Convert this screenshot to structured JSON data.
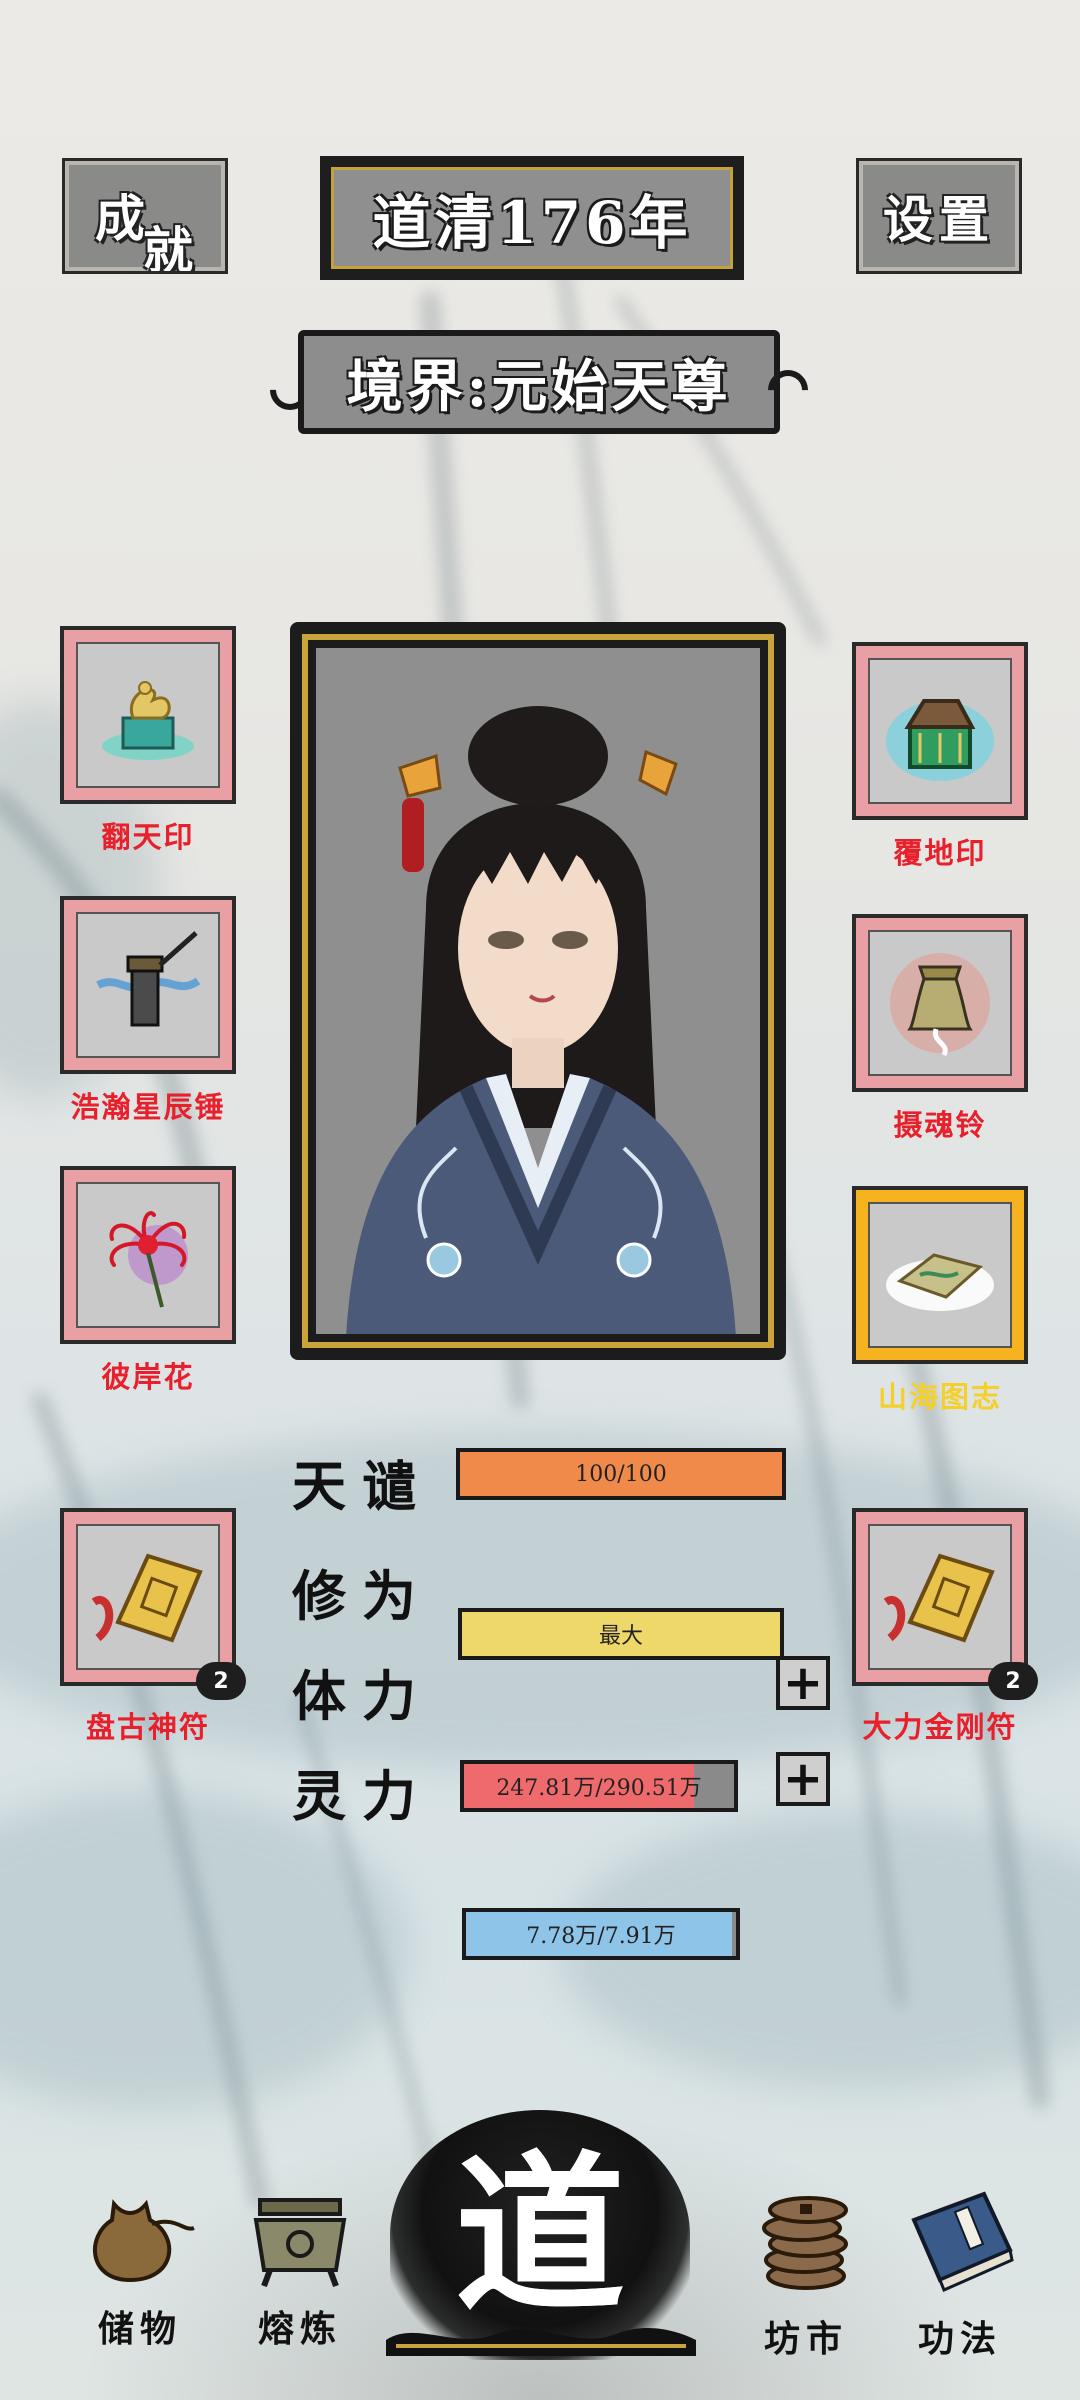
{
  "header": {
    "achievements_label": "成就",
    "achievements_char1": "成",
    "achievements_char2": "就",
    "settings_label": "设置",
    "year_title": "道清176年",
    "realm": "境界:元始天尊"
  },
  "left_slots": [
    {
      "label": "翻天印",
      "icon": "dragon-seal-icon"
    },
    {
      "label": "浩瀚星辰锤",
      "icon": "star-hammer-icon"
    },
    {
      "label": "彼岸花",
      "icon": "red-spider-lily-icon"
    },
    {
      "label": "盘古神符",
      "icon": "talisman-scroll-icon",
      "count": "2"
    }
  ],
  "right_slots": [
    {
      "label": "覆地印",
      "icon": "earth-seal-icon"
    },
    {
      "label": "摄魂铃",
      "icon": "soul-bell-icon"
    },
    {
      "label": "山海图志",
      "icon": "world-map-scroll-icon",
      "highlight": "#f7b21f"
    },
    {
      "label": "大力金刚符",
      "icon": "talisman-scroll-icon",
      "count": "2"
    }
  ],
  "stats": {
    "tianqian": {
      "label": "天谴",
      "text": "100/100",
      "fill": 1.0,
      "color": "#f08a4b"
    },
    "xiuwei": {
      "label": "修为",
      "text": "最大",
      "fill": 1.0,
      "color": "#efd86a"
    },
    "tili": {
      "label": "体力",
      "text": "247.81万/290.51万",
      "fill": 0.853,
      "color": "#ef6a6d"
    },
    "lingli": {
      "label": "灵力",
      "text": "7.78万/7.91万",
      "fill": 0.984,
      "color": "#8ec4e8"
    }
  },
  "nav": {
    "storage": "储物",
    "smelt": "熔炼",
    "dao": "道",
    "market": "坊市",
    "techniques": "功法"
  }
}
